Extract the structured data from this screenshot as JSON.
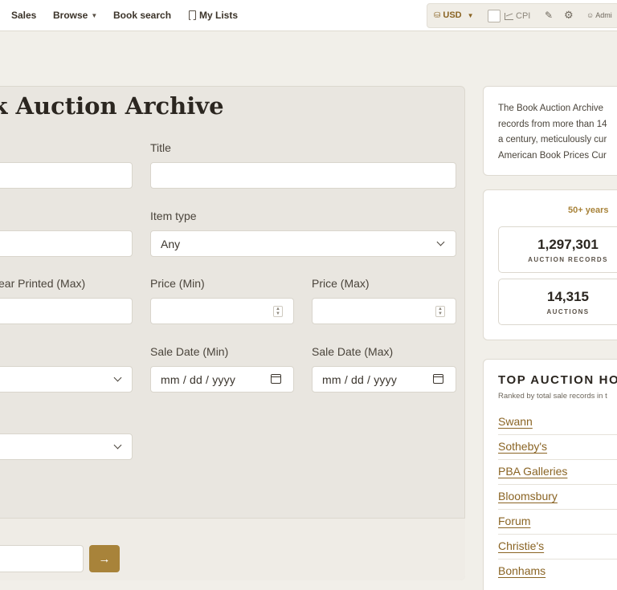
{
  "nav": {
    "sales": "Sales",
    "browse": "Browse",
    "book_search": "Book search",
    "my_lists": "My Lists",
    "currency": "USD",
    "cpi": "CPI",
    "admin": "Admi"
  },
  "search": {
    "title": "ok Auction Archive",
    "labels": {
      "title": "Title",
      "item_type": "Item type",
      "year_printed_max": "ear Printed (Max)",
      "price_min": "Price (Min)",
      "price_max": "Price (Max)",
      "sale_date_min": "Sale Date (Min)",
      "sale_date_max": "Sale Date (Max)"
    },
    "item_type_value": "Any",
    "date_placeholder": "mm / dd / yyyy"
  },
  "about": {
    "lines": [
      "The Book Auction Archive",
      "records from more than 14",
      "a century, meticulously cur",
      "American Book Prices Cur"
    ]
  },
  "stats": {
    "years_label": "50+ years",
    "auction_records_value": "1,297,301",
    "auction_records_label": "AUCTION RECORDS",
    "auctions_value": "14,315",
    "auctions_label": "AUCTIONS"
  },
  "houses": {
    "title": "TOP AUCTION HO",
    "subtitle": "Ranked by total sale records in t",
    "items": [
      "Swann",
      "Sotheby's",
      "PBA Galleries",
      "Bloomsbury",
      "Forum",
      "Christie's",
      "Bonhams"
    ]
  },
  "colors": {
    "accent": "#a8833a",
    "link": "#8a6424",
    "background": "#f1efe9"
  }
}
